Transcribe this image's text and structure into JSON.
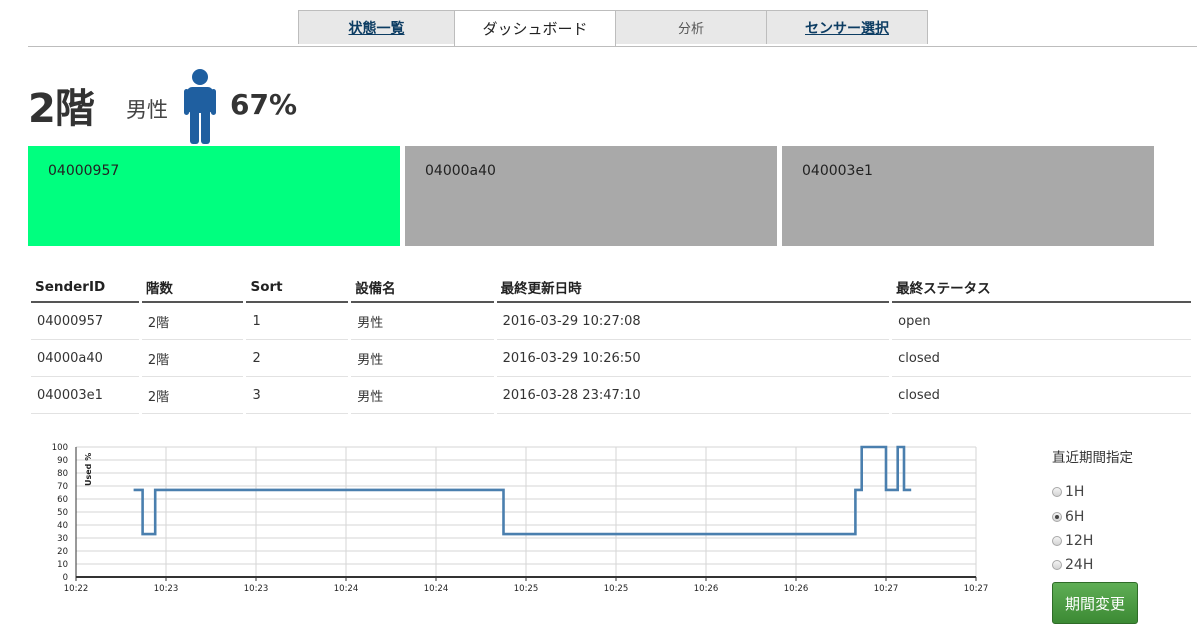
{
  "tabs": [
    {
      "label": "状態一覧"
    },
    {
      "label": "ダッシュボード"
    },
    {
      "label": "分析"
    },
    {
      "label": "センサー選択"
    }
  ],
  "header": {
    "floor": "2階",
    "gender": "男性",
    "percent": "67%",
    "person_color": "#1f5fa0"
  },
  "tiles": [
    {
      "id": "04000957",
      "color": "#00ff7f"
    },
    {
      "id": "04000a40",
      "color": "#a9a9a9"
    },
    {
      "id": "040003e1",
      "color": "#a9a9a9"
    }
  ],
  "table": {
    "headers": [
      "SenderID",
      "階数",
      "Sort",
      "設備名",
      "最終更新日時",
      "最終ステータス"
    ],
    "rows": [
      [
        "04000957",
        "2階",
        "1",
        "男性",
        "2016-03-29 10:27:08",
        "open"
      ],
      [
        "04000a40",
        "2階",
        "2",
        "男性",
        "2016-03-29 10:26:50",
        "closed"
      ],
      [
        "040003e1",
        "2階",
        "3",
        "男性",
        "2016-03-28 23:47:10",
        "closed"
      ]
    ]
  },
  "chart_data": {
    "type": "line",
    "ylabel": "Used %",
    "ylim": [
      0,
      100
    ],
    "y_ticks": [
      0,
      10,
      20,
      30,
      40,
      50,
      60,
      70,
      80,
      90,
      100
    ],
    "x_tick_labels": [
      "10:22",
      "10:23",
      "10:23",
      "10:24",
      "10:24",
      "10:25",
      "10:25",
      "10:26",
      "10:26",
      "10:27",
      "10:27"
    ],
    "grid": true,
    "line_color": "#4a7fae",
    "series": [
      {
        "x": [
          0.64,
          0.74,
          0.74,
          0.88,
          0.88,
          4.75,
          4.75,
          8.66,
          8.66,
          8.73,
          8.73,
          9.0,
          9.0,
          9.13,
          9.13,
          9.2,
          9.2,
          9.28
        ],
        "y": [
          67,
          67,
          33,
          33,
          67,
          67,
          33,
          33,
          67,
          67,
          100,
          100,
          67,
          67,
          100,
          100,
          67,
          67
        ]
      }
    ]
  },
  "periods": {
    "title": "直近期間指定",
    "options": [
      {
        "label": "1H",
        "selected": false
      },
      {
        "label": "6H",
        "selected": true
      },
      {
        "label": "12H",
        "selected": false
      },
      {
        "label": "24H",
        "selected": false
      }
    ],
    "button_label": "期間変更"
  }
}
